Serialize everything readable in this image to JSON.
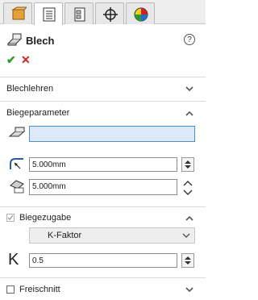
{
  "feature": {
    "title": "Blech",
    "help_symbol": "?",
    "ok_symbol": "✔",
    "cancel_symbol": "✕"
  },
  "sections": {
    "blechlehren": {
      "label": "Blechlehren",
      "expanded": false
    },
    "biegeparameter": {
      "label": "Biegeparameter",
      "expanded": true,
      "fixed_face_value": "",
      "bend_radius_value": "5.000mm",
      "thickness_value": "5.000mm"
    },
    "biegezugabe": {
      "label": "Biegezugabe",
      "checked": true,
      "expanded": true,
      "type_selected": "K-Faktor",
      "k_symbol": "K",
      "k_value": "0.5"
    },
    "freischnitt": {
      "label": "Freischnitt",
      "checked": false,
      "expanded": false
    }
  },
  "tabs": [
    {
      "icon": "feature-manager-icon",
      "active": false
    },
    {
      "icon": "property-manager-icon",
      "active": true
    },
    {
      "icon": "configuration-manager-icon",
      "active": false
    },
    {
      "icon": "dimxpert-manager-icon",
      "active": false
    },
    {
      "icon": "display-manager-icon",
      "active": false
    }
  ],
  "colors": {
    "ok_green": "#2e9a2e",
    "cancel_red": "#d62020",
    "selection_blue": "#4f8fd0"
  }
}
